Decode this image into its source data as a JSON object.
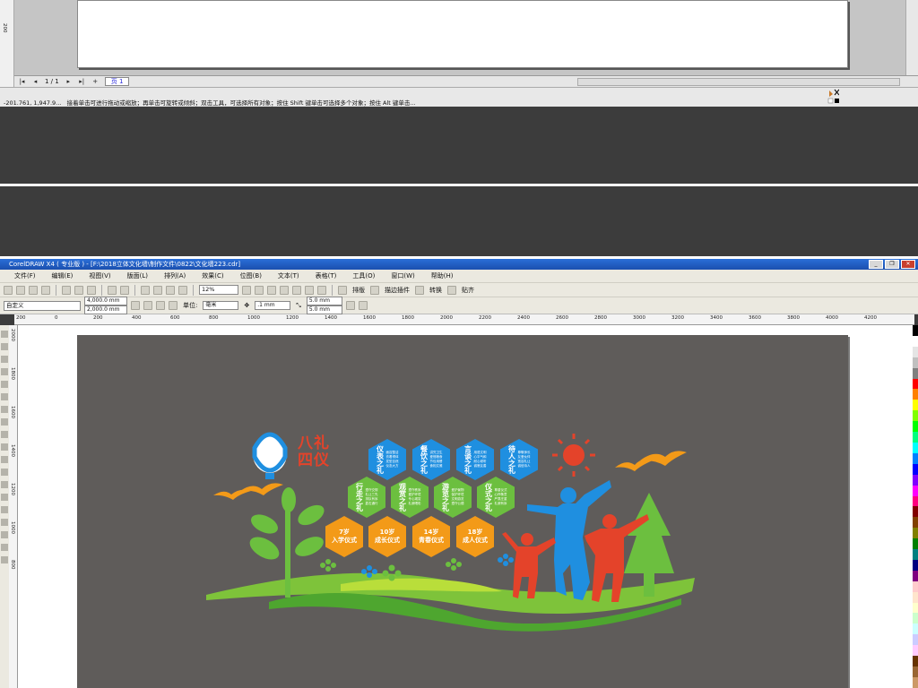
{
  "top_window": {
    "ruler_label": "200",
    "page_counter": "1 / 1",
    "page_tab": "页 1",
    "status_coords": "-201.761, 1,947.9...",
    "status_hint": "接着单击可进行拖动或缩放；再单击可旋转或倾斜；双击工具，可选择所有对象；按住 Shift 键单击可选择多个对象；按住 Alt 键单击..."
  },
  "window": {
    "title": "CorelDRAW X4 ( 专业版 ) - [F:\\2018立体文化墙\\制作文件\\0822\\文化墙223.cdr]",
    "controls": [
      "_",
      "❐",
      "✕"
    ]
  },
  "menu": [
    "文件(F)",
    "编辑(E)",
    "视图(V)",
    "版面(L)",
    "排列(A)",
    "效果(C)",
    "位图(B)",
    "文本(T)",
    "表格(T)",
    "工具(O)",
    "窗口(W)",
    "帮助(H)"
  ],
  "toolbar": {
    "zoom": "12%",
    "plugin_labels": [
      "排版",
      "描边插件",
      "转换",
      "贴齐"
    ]
  },
  "property_bar": {
    "preset": "自定义",
    "width": "4,000.0 mm",
    "height": "2,000.0 mm",
    "unit_label": "单位:",
    "unit": "毫米",
    "nudge": ".1 mm",
    "dup_x": "5.0 mm",
    "dup_y": "5.0 mm"
  },
  "ruler_ticks": [
    "200",
    "0",
    "200",
    "400",
    "600",
    "800",
    "1000",
    "1200",
    "1400",
    "1600",
    "1800",
    "2000",
    "2200",
    "2400",
    "2600",
    "2800",
    "3000",
    "3200",
    "3400",
    "3600",
    "3800",
    "4000",
    "4200"
  ],
  "vruler_ticks": [
    "2000",
    "1800",
    "1600",
    "1400",
    "1200",
    "1000",
    "800"
  ],
  "artwork": {
    "title_line1": "八礼",
    "title_line2": "四仪",
    "blue_hexes": [
      {
        "title": "仪表之礼",
        "desc": "面容整洁 衣着得体 发型自然 仪态大方"
      },
      {
        "title": "餐饮之礼",
        "desc": "讲究卫生 爱惜粮食 节俭用餐 食相文雅"
      },
      {
        "title": "言谈之礼",
        "desc": "用语文明 心平气和 耐心倾听 诚恳友善"
      },
      {
        "title": "待人之礼",
        "desc": "尊敬师长 友爱伙伴 宽容礼让 诚信待人"
      }
    ],
    "green_hexes": [
      {
        "title": "行走之礼",
        "desc": "遵守交规 礼让三先 排队有序 靠右通行"
      },
      {
        "title": "观赏之礼",
        "desc": "遵守秩序 爱护环境 专心观赏 礼貌喝彩"
      },
      {
        "title": "游览之礼",
        "desc": "爱护景物 保护环境 文明游览 遵守公德"
      },
      {
        "title": "仪式之礼",
        "desc": "尊重仪式 心怀敬意 严肃庄重 礼貌有序"
      }
    ],
    "orange_hexes": [
      {
        "age": "7岁",
        "rite": "入学仪式"
      },
      {
        "age": "10岁",
        "rite": "成长仪式"
      },
      {
        "age": "14岁",
        "rite": "青春仪式"
      },
      {
        "age": "18岁",
        "rite": "成人仪式"
      }
    ],
    "colors": {
      "blue": "#1f8fe0",
      "green": "#6cbf3f",
      "orange": "#f39a18",
      "red": "#e4432a",
      "wave": "#7ec33a",
      "wall": "#5f5c5a"
    }
  },
  "palette_colors": [
    "#000000",
    "#ffffff",
    "#e5e5e5",
    "#c0c0c0",
    "#808080",
    "#ff0000",
    "#ff8000",
    "#ffff00",
    "#80ff00",
    "#00ff00",
    "#00ff80",
    "#00ffff",
    "#0080ff",
    "#0000ff",
    "#8000ff",
    "#ff00ff",
    "#ff0080",
    "#800000",
    "#804000",
    "#808000",
    "#008000",
    "#008080",
    "#000080",
    "#800080",
    "#ffcccc",
    "#ffe5cc",
    "#ffffcc",
    "#ccffcc",
    "#ccffff",
    "#ccccff",
    "#ffccff",
    "#663300",
    "#996633",
    "#cc9966"
  ],
  "icons": [
    "arrow-tool-icon",
    "shape-tool-icon",
    "zoom-tool-icon",
    "freehand-tool-icon",
    "rectangle-tool-icon",
    "ellipse-tool-icon",
    "polygon-tool-icon",
    "text-tool-icon",
    "fill-tool-icon",
    "eyedropper-tool-icon"
  ]
}
